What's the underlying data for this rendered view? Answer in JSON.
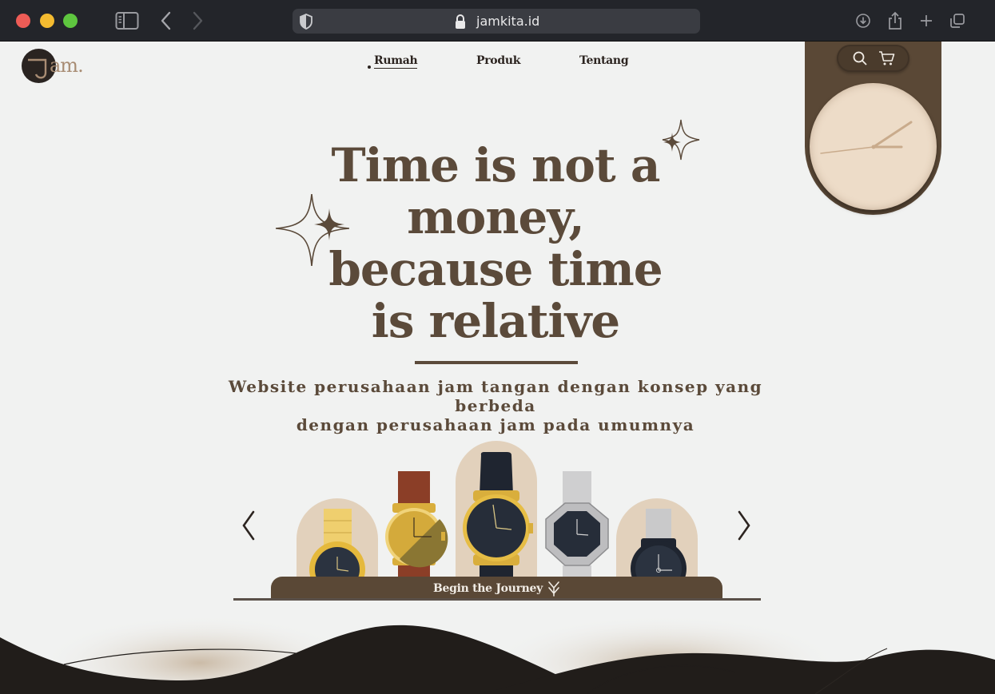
{
  "browser": {
    "url": "jamkita.id"
  },
  "logo": {
    "text": "am."
  },
  "nav": {
    "items": [
      {
        "label": "Rumah"
      },
      {
        "label": "Produk"
      },
      {
        "label": "Tentang"
      }
    ]
  },
  "hero": {
    "headline_lines": [
      "Time is not a",
      "money,",
      "because time",
      "is relative"
    ],
    "subtitle_lines": [
      "Website perusahaan jam tangan dengan konsep yang berbeda",
      "dengan perusahaan jam pada umumnya"
    ]
  },
  "carousel": {
    "cta_label": "Begin the Journey",
    "watches": [
      "gold-bracelet-watch",
      "brown-leather-watch",
      "black-leather-gold-watch",
      "silver-octagon-watch",
      "silver-strap-watch"
    ]
  },
  "colors": {
    "brand_brown": "#5a4836",
    "headline": "#5b4a3a",
    "cream": "#eddcc8",
    "background": "#f1f2f1"
  }
}
